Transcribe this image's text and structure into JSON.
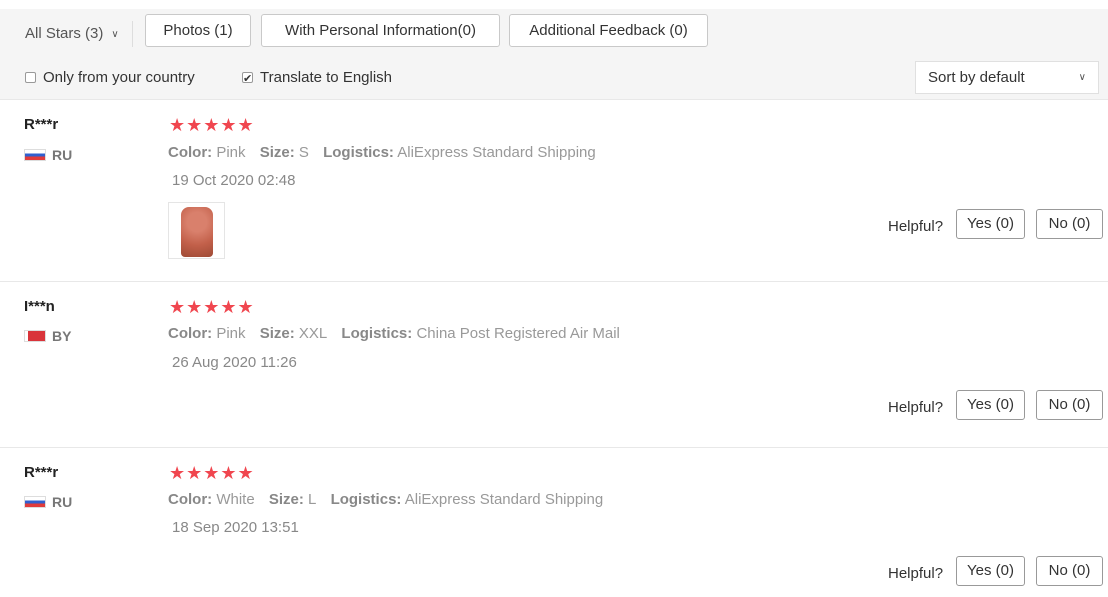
{
  "filters": {
    "stars_label": "All Stars (3)",
    "chips": [
      "Photos (1)",
      "With Personal Information(0)",
      "Additional Feedback (0)"
    ],
    "only_country_label": "Only from your country",
    "translate_label": "Translate to English",
    "sort_label": "Sort by default"
  },
  "reviews": [
    {
      "user": "R***r",
      "country": "RU",
      "stars": "★★★★★",
      "color_key": "Color:",
      "color_val": "Pink",
      "size_key": "Size:",
      "size_val": "S",
      "logistics_key": "Logistics:",
      "logistics_val": "AliExpress Standard Shipping",
      "date": "19 Oct 2020 02:48",
      "helpful": "Helpful?",
      "yes": "Yes (0)",
      "no": "No (0)"
    },
    {
      "user": "I***n",
      "country": "BY",
      "stars": "★★★★★",
      "color_key": "Color:",
      "color_val": "Pink",
      "size_key": "Size:",
      "size_val": "XXL",
      "logistics_key": "Logistics:",
      "logistics_val": "China Post Registered Air Mail",
      "date": "26 Aug 2020 11:26",
      "helpful": "Helpful?",
      "yes": "Yes (0)",
      "no": "No (0)"
    },
    {
      "user": "R***r",
      "country": "RU",
      "stars": "★★★★★",
      "color_key": "Color:",
      "color_val": "White",
      "size_key": "Size:",
      "size_val": "L",
      "logistics_key": "Logistics:",
      "logistics_val": "AliExpress Standard Shipping",
      "date": "18 Sep 2020 13:51",
      "helpful": "Helpful?",
      "yes": "Yes (0)",
      "no": "No (0)"
    }
  ],
  "colors": {
    "star": "#f0464f",
    "filter_bg": "#f5f5f5"
  }
}
